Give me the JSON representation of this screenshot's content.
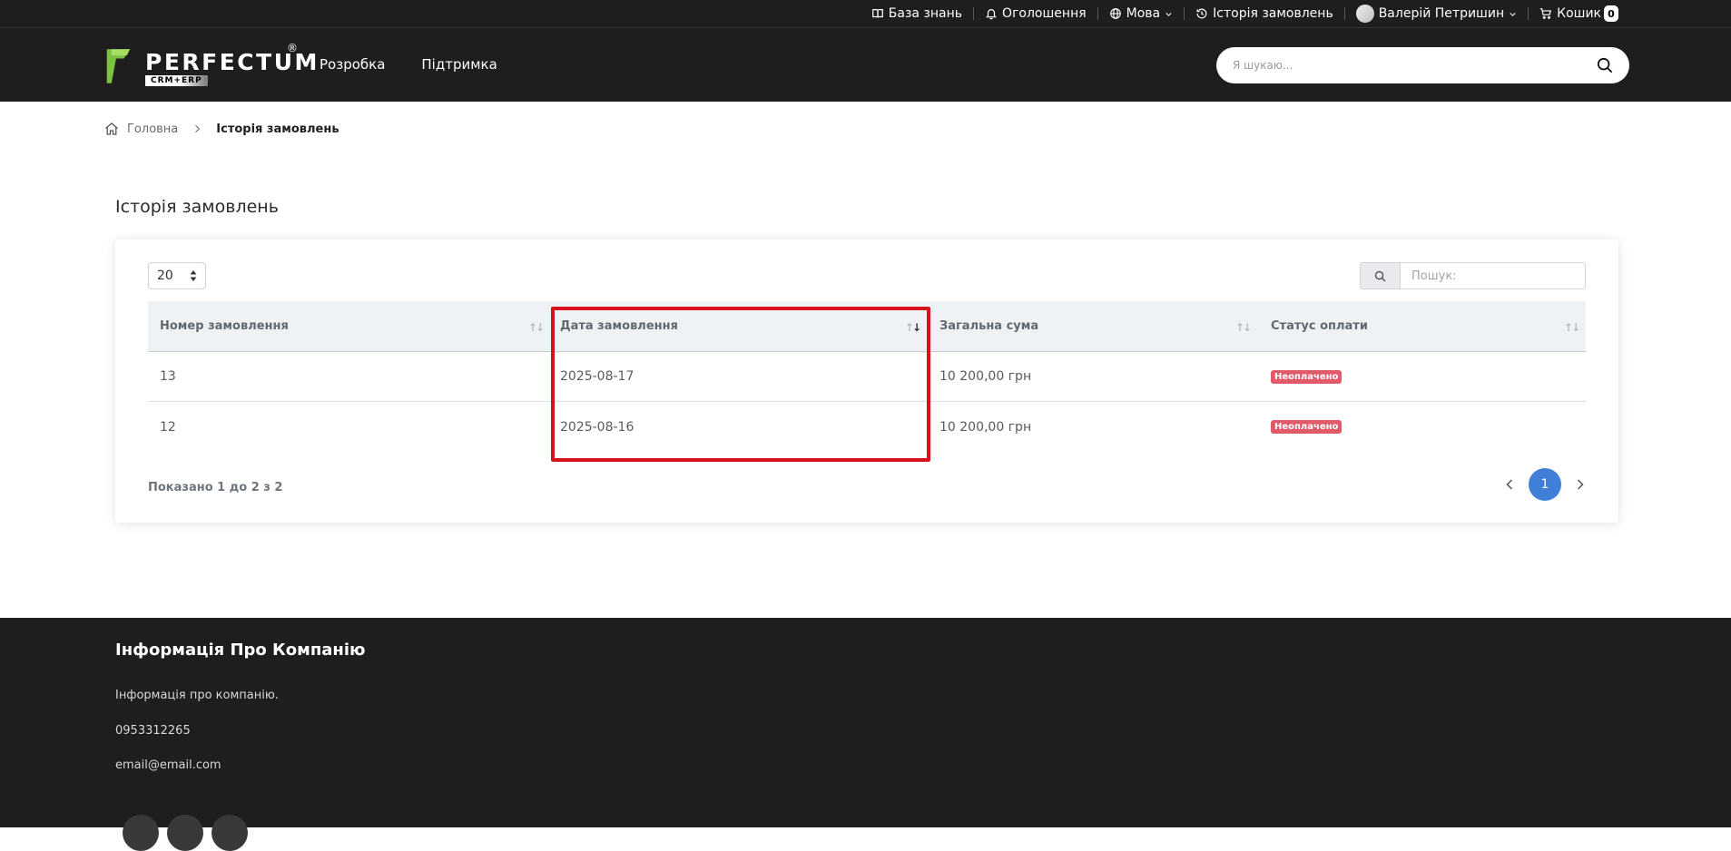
{
  "topbar": {
    "knowledge_base": "База знань",
    "announcements": "Оголошення",
    "language": "Мова",
    "order_history": "Історія замовлень",
    "user_name": "Валерій Петришин",
    "cart": "Кошик",
    "cart_count": "0"
  },
  "header": {
    "logo_text": "PERFECTUM",
    "logo_sub": "CRM+ERP",
    "logo_reg": "®",
    "nav": [
      "Розробка",
      "Підтримка"
    ],
    "search_placeholder": "Я шукаю..."
  },
  "breadcrumb": {
    "home": "Головна",
    "current": "Історія замовлень"
  },
  "page": {
    "title": "Історія замовлень"
  },
  "table": {
    "page_length": "20",
    "search_placeholder": "Пошук:",
    "columns": [
      "Номер замовлення",
      "Дата замовлення",
      "Загальна сума",
      "Статус оплати"
    ],
    "rows": [
      {
        "number": "13",
        "date": "2025-08-17",
        "total": "10 200,00 грн",
        "status": "Неоплачено"
      },
      {
        "number": "12",
        "date": "2025-08-16",
        "total": "10 200,00 грн",
        "status": "Неоплачено"
      }
    ],
    "info": "Показано 1 до 2 з 2",
    "current_page": "1"
  },
  "footer": {
    "title": "Інформація Про Компанію",
    "about": "Інформація про компанію.",
    "phone": "0953312265",
    "email": "email@email.com"
  },
  "colors": {
    "dark": "#1f1d1e",
    "accent_green": "#7cc243",
    "badge_red": "#e05a6a",
    "pager_blue": "#3f7fd7",
    "highlight_red": "#d6111b"
  }
}
